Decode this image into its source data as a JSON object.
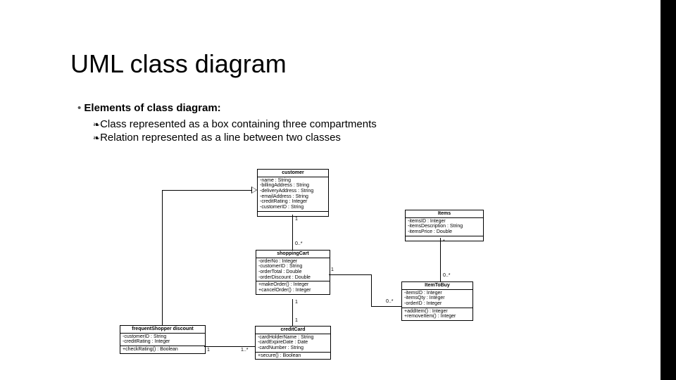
{
  "title": "UML class diagram",
  "bullet_main": "Elements of class diagram:",
  "bullet_sub1": "Class represented as a box containing three compartments",
  "bullet_sub2": "Relation represented as a line between two classes",
  "classes": {
    "customer": {
      "name": "customer",
      "attrs": [
        "-name : String",
        "-billingAddress : String",
        "-deliveryAddress : String",
        "-emailAddress : String",
        "-creditRating : Integer",
        "-customerID : String"
      ],
      "ops": []
    },
    "items": {
      "name": "Items",
      "attrs": [
        "-itemsID : Integer",
        "-itemsDescription : String",
        "-itemsPrice : Double"
      ],
      "ops": []
    },
    "shoppingCart": {
      "name": "shoppingCart",
      "attrs": [
        "-orderNo : Integer",
        "-customerID : String",
        "-orderTotal : Double",
        "-orderDiscount : Double"
      ],
      "ops": [
        "+makeOrder() : Integer",
        "+cancelOrder() : Integer"
      ]
    },
    "itemToBuy": {
      "name": "ItemToBuy",
      "attrs": [
        "-itemsID : Integer",
        "-itemsQty : Integer",
        "-orderID : Integer"
      ],
      "ops": [
        "+addItem() : Integer",
        "+removeItem() : Integer"
      ]
    },
    "creditCard": {
      "name": "creditCard",
      "attrs": [
        "-cardHolderName : String",
        "-cardExpireDate : Date",
        "-cardNumber : String"
      ],
      "ops": [
        "+secure() : Boolean"
      ]
    },
    "frequentShopper": {
      "name": "frequentShopper discount",
      "attrs": [
        "-customerID : String",
        "-creditRating : Integer"
      ],
      "ops": [
        "+checkRating() : Boolean"
      ]
    }
  },
  "multiplicities": {
    "cust_cart_top": "1",
    "cust_cart_bot": "0..*",
    "cart_item_l": "1",
    "cart_item_r": "0..*",
    "cart_card_top": "1",
    "cart_card_bot": "1",
    "freq_card_l": "1",
    "freq_card_r": "1..*",
    "items_itemToBuy_top": "*",
    "items_itemToBuy_bot": "0..*"
  }
}
